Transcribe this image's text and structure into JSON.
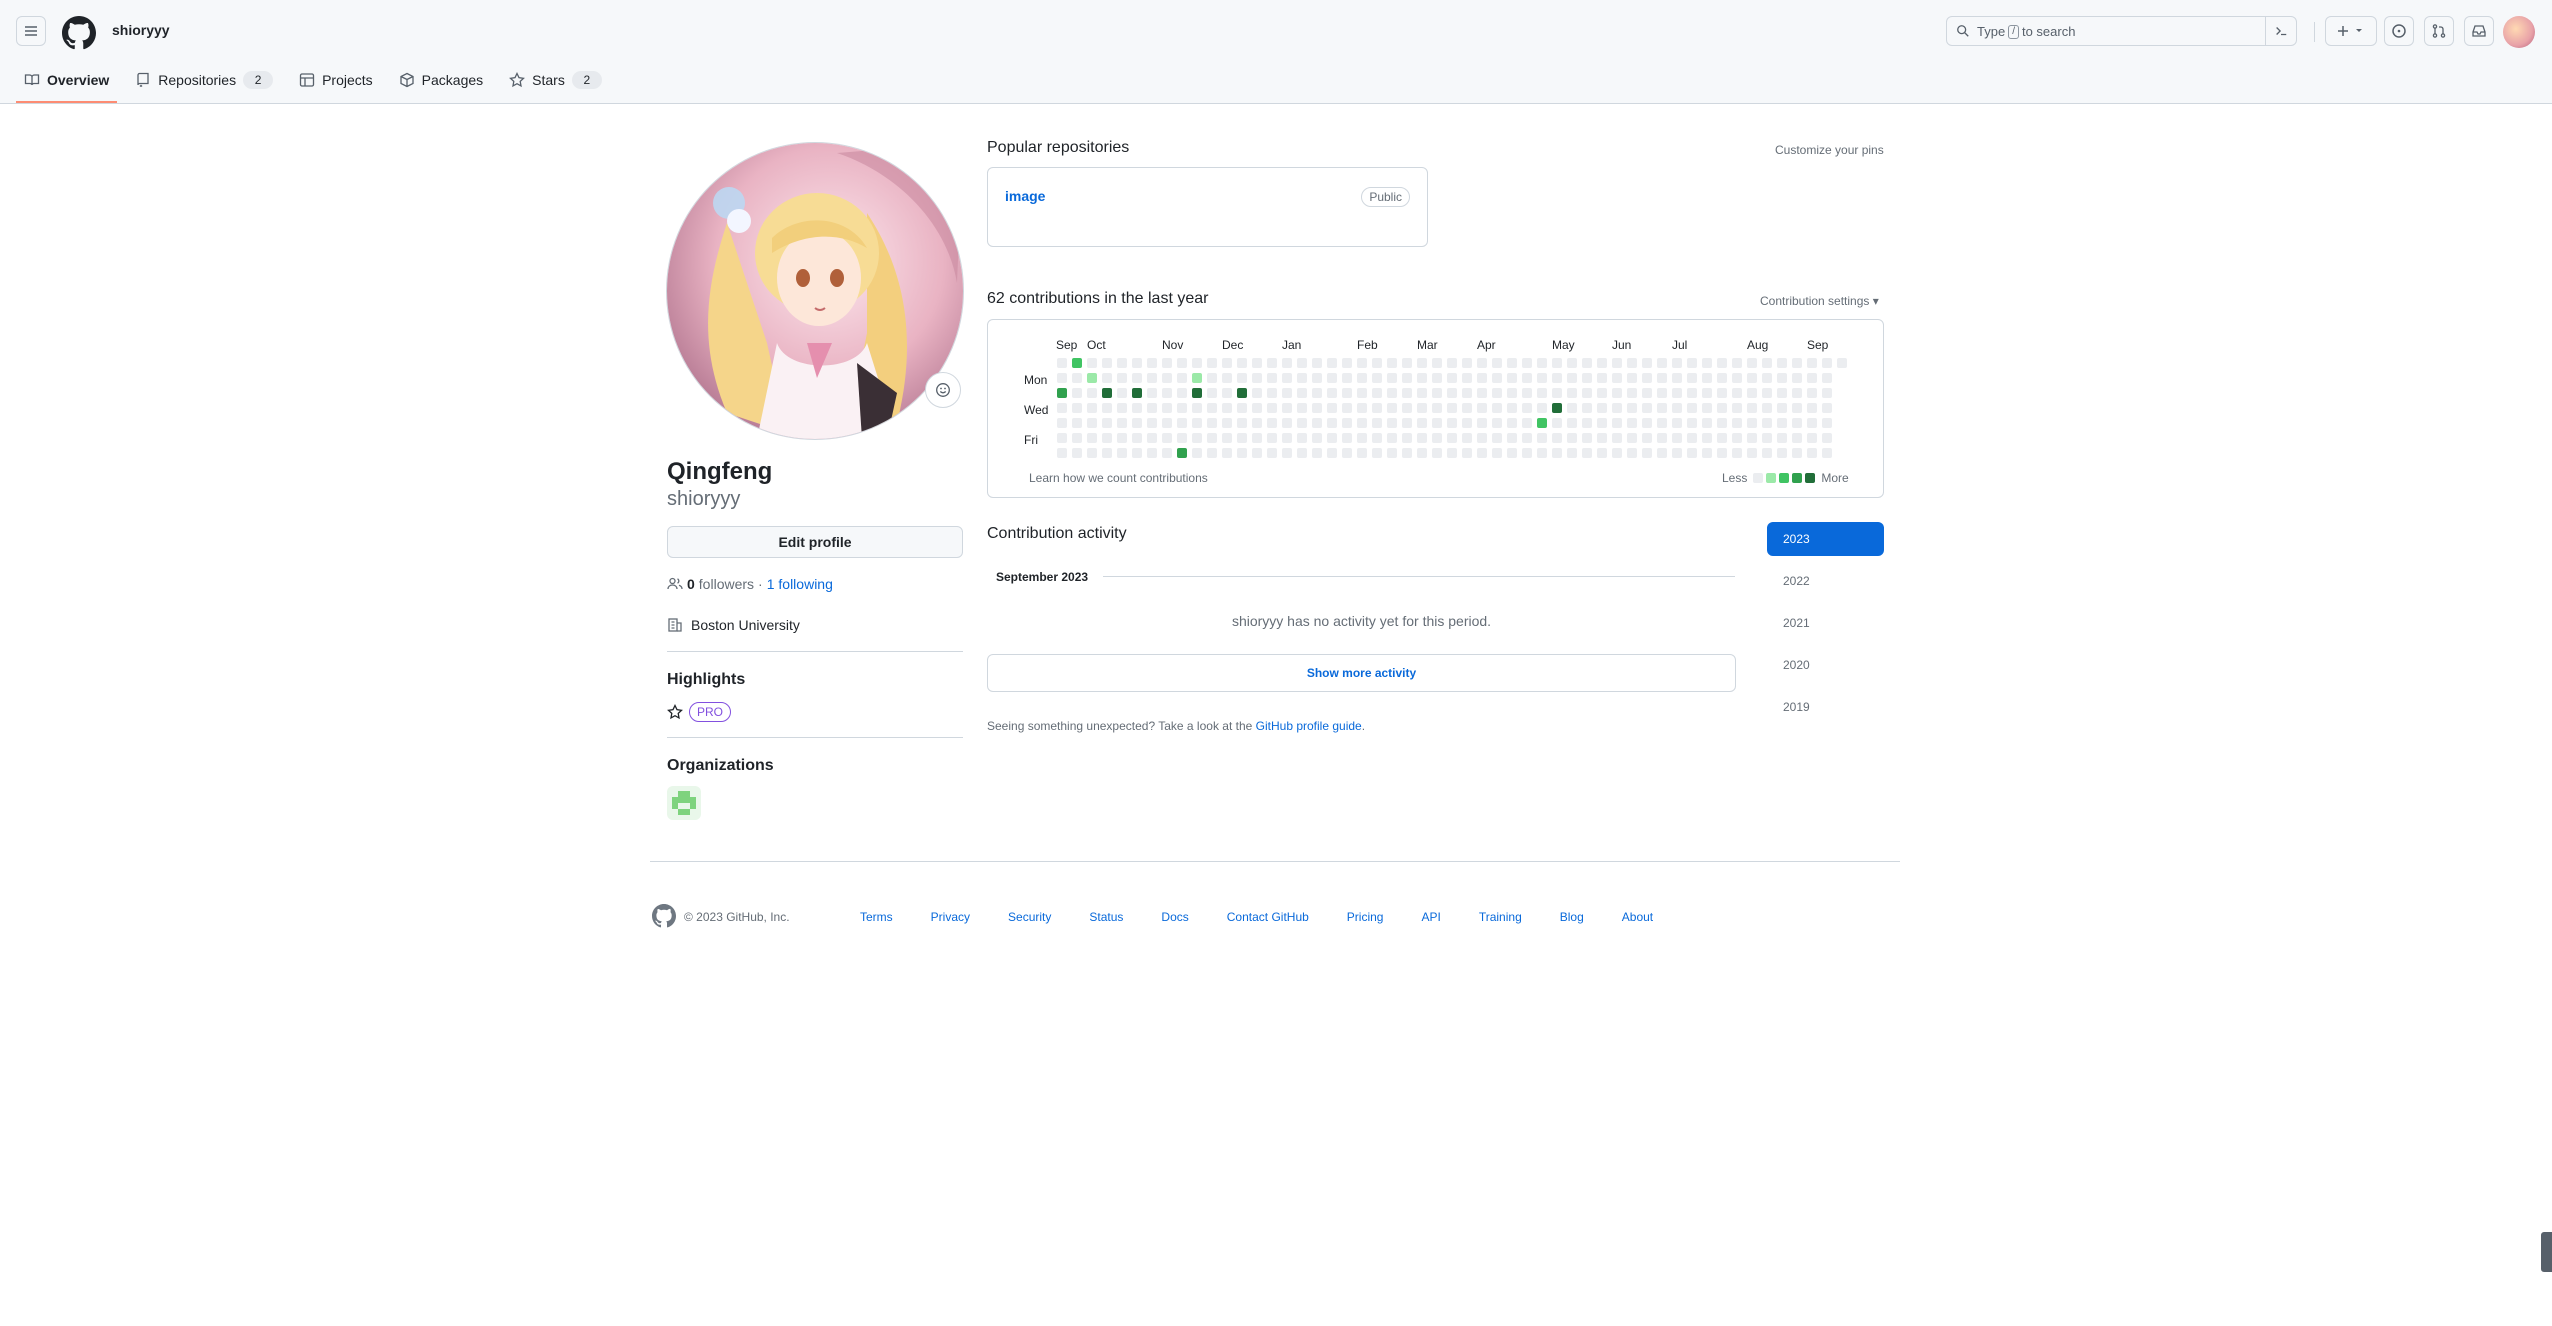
{
  "header": {
    "username": "shioryyy",
    "search_prefix": "Type",
    "search_key": "/",
    "search_suffix": "to search"
  },
  "tabs": [
    {
      "label": "Overview",
      "count": ""
    },
    {
      "label": "Repositories",
      "count": "2"
    },
    {
      "label": "Projects",
      "count": ""
    },
    {
      "label": "Packages",
      "count": ""
    },
    {
      "label": "Stars",
      "count": "2"
    }
  ],
  "profile": {
    "name": "Qingfeng",
    "login": "shioryyy",
    "edit_label": "Edit profile",
    "followers_count": "0",
    "followers_label": "followers",
    "separator": "·",
    "following_label": "1 following",
    "organization": "Boston University",
    "highlights_title": "Highlights",
    "pro_label": "PRO",
    "orgs_title": "Organizations"
  },
  "pinned": {
    "title": "Popular repositories",
    "customize": "Customize your pins",
    "repos": [
      {
        "name": "image",
        "visibility": "Public"
      }
    ]
  },
  "contributions": {
    "title": "62 contributions in the last year",
    "settings": "Contribution settings ▾",
    "months": [
      "Sep",
      "Oct",
      "Nov",
      "Dec",
      "Jan",
      "Feb",
      "Mar",
      "Apr",
      "May",
      "Jun",
      "Jul",
      "Aug",
      "Sep"
    ],
    "days": [
      "Mon",
      "Wed",
      "Fri"
    ],
    "learn": "Learn how we count contributions",
    "less": "Less",
    "more": "More",
    "colors": [
      "#ebedf0",
      "#9be9a8",
      "#40c463",
      "#30a14e",
      "#216e39"
    ],
    "cells": [
      {
        "week": 1,
        "day": 0,
        "level": 2
      },
      {
        "week": 0,
        "day": 2,
        "level": 3
      },
      {
        "week": 2,
        "day": 1,
        "level": 1
      },
      {
        "week": 3,
        "day": 2,
        "level": 4
      },
      {
        "week": 5,
        "day": 2,
        "level": 4
      },
      {
        "week": 8,
        "day": 6,
        "level": 3
      },
      {
        "week": 9,
        "day": 1,
        "level": 1
      },
      {
        "week": 9,
        "day": 2,
        "level": 4
      },
      {
        "week": 12,
        "day": 2,
        "level": 4
      },
      {
        "week": 32,
        "day": 4,
        "level": 2
      },
      {
        "week": 33,
        "day": 3,
        "level": 4
      }
    ]
  },
  "activity": {
    "title": "Contribution activity",
    "month": "September 2023",
    "no_activity": "shioryyy has no activity yet for this period.",
    "show_more": "Show more activity",
    "unexpected": "Seeing something unexpected? Take a look at the",
    "guide_link": "GitHub profile guide",
    "years": [
      "2023",
      "2022",
      "2021",
      "2020",
      "2019"
    ]
  },
  "footer": {
    "copyright": "© 2023 GitHub, Inc.",
    "links": [
      "Terms",
      "Privacy",
      "Security",
      "Status",
      "Docs",
      "Contact GitHub",
      "Pricing",
      "API",
      "Training",
      "Blog",
      "About"
    ]
  }
}
